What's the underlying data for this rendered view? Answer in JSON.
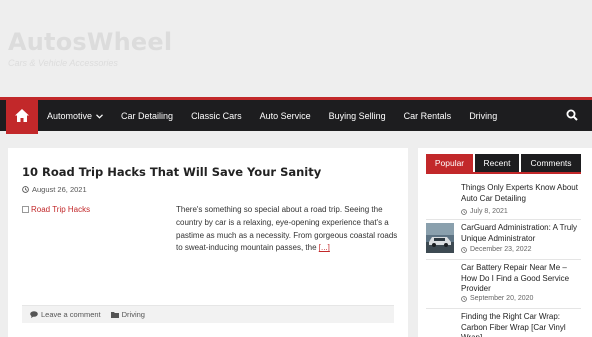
{
  "site": {
    "title": "AutosWheel",
    "tagline": "Cars & Vehicle Accessories"
  },
  "nav": {
    "items": [
      {
        "label": "Automotive",
        "has_dropdown": true
      },
      {
        "label": "Car Detailing"
      },
      {
        "label": "Classic Cars"
      },
      {
        "label": "Auto Service"
      },
      {
        "label": "Buying Selling"
      },
      {
        "label": "Car Rentals"
      },
      {
        "label": "Driving"
      }
    ],
    "home_icon": "home-icon",
    "search_icon": "search-icon"
  },
  "post": {
    "title": "10 Road Trip Hacks That Will Save Your Sanity",
    "date": "August 26, 2021",
    "image_alt": "Road Trip Hacks",
    "excerpt": "There's something so special about a road trip. Seeing the country by car is a relaxing, eye-opening experience that's a pastime as much as a necessity. From gorgeous coastal roads to sweat-inducing mountain passes, the",
    "read_more": "[...]",
    "comment_label": "Leave a comment",
    "category": "Driving"
  },
  "sidebar": {
    "tabs": [
      {
        "label": "Popular",
        "active": true
      },
      {
        "label": "Recent",
        "active": false
      },
      {
        "label": "Comments",
        "active": false
      }
    ],
    "items": [
      {
        "title": "Things Only Experts Know About Auto Car Detailing",
        "date": "July 8, 2021"
      },
      {
        "title": "CarGuard Administration: A Truly Unique Administrator",
        "date": "December 23, 2022"
      },
      {
        "title": "Car Battery Repair Near Me – How Do I Find a Good Service Provider",
        "date": "September 20, 2020"
      },
      {
        "title": "Finding the Right Car Wrap: Carbon Fiber Wrap [Car Vinyl Wrap]",
        "date": ""
      }
    ]
  },
  "colors": {
    "accent": "#c2282a",
    "navbar": "#1d1d1f",
    "background": "#eeeeee"
  }
}
